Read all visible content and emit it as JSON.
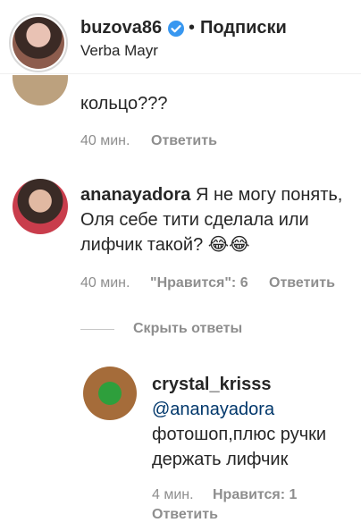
{
  "header": {
    "username": "buzova86",
    "separator": "•",
    "follow_label": "Подписки",
    "location": "Verba Mayr"
  },
  "comments": [
    {
      "text": "кольцо???",
      "time": "40 мин.",
      "reply": "Ответить"
    },
    {
      "username": "ananayadora",
      "text_line1": "Я не могу понять,",
      "text_line2": "Оля себе тити сделала или",
      "text_line3": "лифчик такой?",
      "emoji": "😂😂",
      "time": "40 мин.",
      "likes": "\"Нравится\": 6",
      "reply": "Ответить"
    }
  ],
  "hide_replies": "Скрыть ответы",
  "reply": {
    "username": "crystal_krisss",
    "mention": "@ananayadora",
    "text_line1": "фотошоп,плюс ручки",
    "text_line2": "держать лифчик",
    "time": "4 мин.",
    "likes": "Нравится: 1",
    "reply": "Ответить"
  },
  "colors": {
    "text": "#262626",
    "secondary": "#8e8e8e",
    "mention": "#00376b",
    "verified": "#3897f0"
  },
  "icons": {
    "verified": "verified-badge-icon"
  }
}
